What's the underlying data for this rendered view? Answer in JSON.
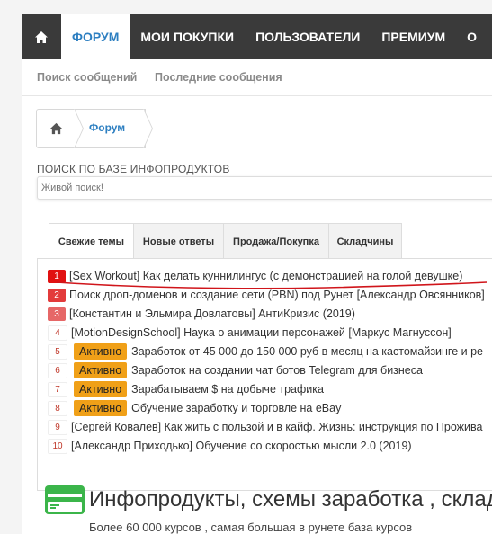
{
  "topnav": {
    "tabs": [
      {
        "label": "ФОРУМ"
      },
      {
        "label": "МОИ ПОКУПКИ"
      },
      {
        "label": "ПОЛЬЗОВАТЕЛИ"
      },
      {
        "label": "ПРЕМИУМ"
      },
      {
        "label": "О"
      }
    ]
  },
  "subnav": {
    "search_posts": "Поиск сообщений",
    "recent_posts": "Последние сообщения"
  },
  "breadcrumb": {
    "forum": "Форум"
  },
  "search": {
    "title": "ПОИСК ПО БАЗЕ ИНФОПРОДУКТОВ",
    "placeholder": "Живой поиск!"
  },
  "content_tabs": [
    {
      "label": "Свежие темы"
    },
    {
      "label": "Новые ответы"
    },
    {
      "label": "Продажа/Покупка"
    },
    {
      "label": "Складчины"
    }
  ],
  "threads": [
    {
      "num": "1",
      "num_color": "#e11111",
      "badge": "",
      "title": "[Sex Workout] Как делать куннилингус (с демонстрацией на голой девушке)"
    },
    {
      "num": "2",
      "num_color": "#e33b3b",
      "badge": "",
      "title": "Поиск дроп-доменов и создание сети (PBN) под Рунет [Александр Овсянников]"
    },
    {
      "num": "3",
      "num_color": "#e66767",
      "badge": "",
      "title": "[Константин и Эльмира Довлатовы] АнтиКризис (2019)"
    },
    {
      "num": "4",
      "num_color": "#ffffff",
      "badge": "",
      "title": "[MotionDesignSchool] Наука о анимации персонажей [Маркус Магнуссон]"
    },
    {
      "num": "5",
      "num_color": "#ffffff",
      "badge": "Активно",
      "title": "Заработок от 45 000 до 150 000 руб в месяц на кастомайзинге и ре"
    },
    {
      "num": "6",
      "num_color": "#ffffff",
      "badge": "Активно",
      "title": "Заработок на создании чат ботов Telegram для бизнеса"
    },
    {
      "num": "7",
      "num_color": "#ffffff",
      "badge": "Активно",
      "title": "Зарабатываем $ на добыче трафика"
    },
    {
      "num": "8",
      "num_color": "#ffffff",
      "badge": "Активно",
      "title": "Обучение заработку и торговле на eBay"
    },
    {
      "num": "9",
      "num_color": "#ffffff",
      "badge": "",
      "title": "[Сергей Ковалев] Как жить с пользой и в кайф. Жизнь: инструкция по Прожива"
    },
    {
      "num": "10",
      "num_color": "#ffffff",
      "badge": "",
      "title": "[Александр Приходько] Обучение со скоростью мысли 2.0 (2019)"
    }
  ],
  "promo": {
    "title": "Инфопродукты, схемы заработка , складч",
    "subtitle": "Более 60 000 курсов , самая большая в рунете база курсов"
  },
  "icons": [
    "home-icon",
    "credit-card-icon"
  ],
  "colors": {
    "accent": "#2d7fc1",
    "nav_bg": "#3a3a3a",
    "badge_active": "#f0a018",
    "promo_green": "#3bb54a"
  }
}
